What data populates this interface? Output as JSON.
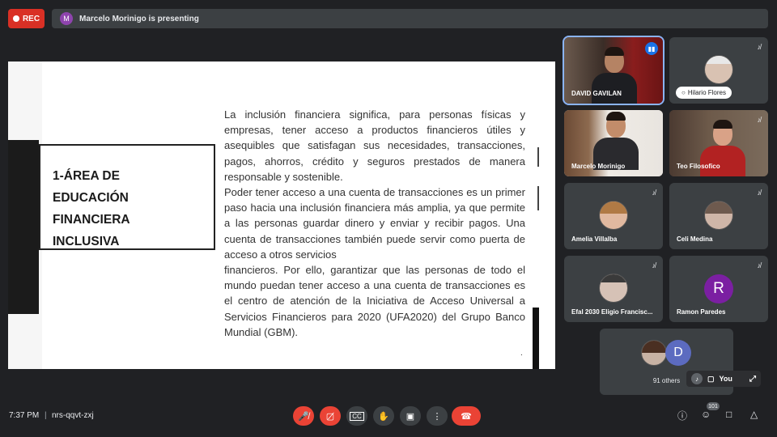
{
  "top": {
    "rec_label": "REC",
    "presenter_initial": "M",
    "presenting_text": "Marcelo Morinigo is presenting"
  },
  "slide": {
    "box_title": [
      "1-ÁREA DE",
      "EDUCACIÓN",
      "FINANCIERA",
      "INCLUSIVA"
    ],
    "paragraph1": "La inclusión financiera significa, para personas físicas y empresas, tener acceso a productos financieros útiles y asequibles que satisfagan sus necesidades, transacciones, pagos, ahorros, crédito y seguros prestados de manera responsable y sostenible.",
    "paragraph2": "Poder tener acceso a una cuenta de transacciones es un primer paso hacia una inclusión financiera más amplia, ya que permite a las personas guardar dinero y enviar y recibir pagos. Una cuenta de transacciones también puede servir como puerta de acceso a otros servicios",
    "paragraph3": "financieros. Por ello, garantizar que las personas de todo el mundo puedan tener acceso a una cuenta de transacciones es el centro de atención de la Iniciativa de Acceso Universal a Servicios Financieros para 2020 (UFA2020) del Grupo Banco Mundial (GBM).",
    "dot": "."
  },
  "participants": [
    {
      "name": "DAVID GAVILAN"
    },
    {
      "name": "Hilario Flores"
    },
    {
      "name": "Marcelo Morinigo"
    },
    {
      "name": "Teo Filosofico"
    },
    {
      "name": "Amelia Villalba"
    },
    {
      "name": "Celi Medina"
    },
    {
      "name": "Efal 2030 Eligio Francisc..."
    },
    {
      "name": "Ramon Paredes",
      "initial": "R"
    }
  ],
  "others": {
    "initial": "D",
    "label": "91 others"
  },
  "self": {
    "label": "You"
  },
  "bottom": {
    "time": "7:37 PM",
    "separator": "|",
    "meeting_code": "nrs-qqvt-zxj",
    "people_count": "101"
  },
  "colors": {
    "end_call": "#ea4335",
    "active_speaker": "#1a73e8",
    "background": "#202124"
  },
  "icons": [
    "mic-off-icon",
    "camera-off-icon",
    "captions-icon",
    "raise-hand-icon",
    "present-icon",
    "more-icon",
    "end-call-icon",
    "info-icon",
    "people-icon",
    "chat-icon",
    "activities-icon"
  ]
}
